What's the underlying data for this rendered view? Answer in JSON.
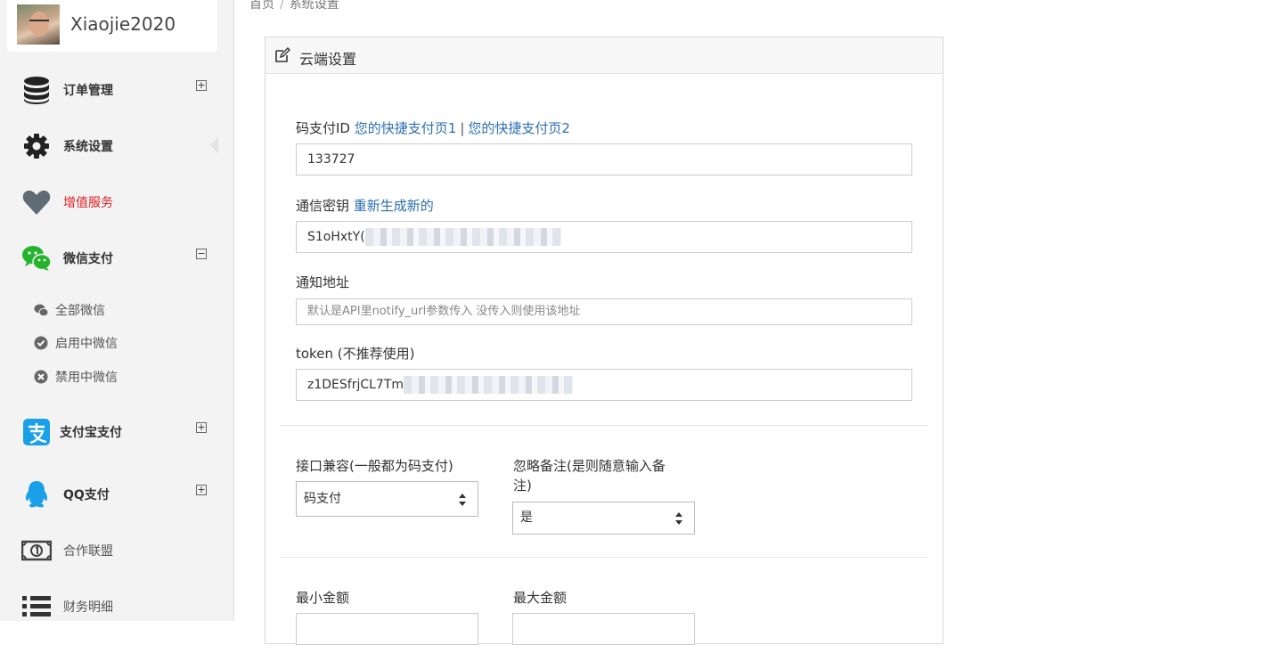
{
  "profile": {
    "username": "Xiaojie2020"
  },
  "sidebar": {
    "items": [
      {
        "label": "订单管理",
        "icon": "database-icon",
        "toggle": "+"
      },
      {
        "label": "系统设置",
        "icon": "gear-icon"
      },
      {
        "label": "增值服务",
        "icon": "heart-icon"
      },
      {
        "label": "微信支付",
        "icon": "wechat-icon",
        "toggle": "−"
      },
      {
        "label": "支付宝支付",
        "icon": "alipay-icon",
        "toggle": "+"
      },
      {
        "label": "QQ支付",
        "icon": "qq-icon",
        "toggle": "+"
      },
      {
        "label": "合作联盟",
        "icon": "money-icon"
      },
      {
        "label": "财务明细",
        "icon": "list-icon"
      }
    ],
    "wechat_sub": [
      {
        "label": "全部微信",
        "icon": "wechat-small-icon"
      },
      {
        "label": "启用中微信",
        "icon": "check-circle-icon"
      },
      {
        "label": "禁用中微信",
        "icon": "x-circle-icon"
      }
    ]
  },
  "breadcrumb": {
    "home": "首页",
    "current": "系统设置"
  },
  "panel": {
    "title": "云端设置",
    "pay_id_label": "码支付ID",
    "pay_link1": "您的快捷支付页1",
    "pay_link_sep": "|",
    "pay_link2": "您的快捷支付页2",
    "pay_id_value": "133727",
    "key_label": "通信密钥",
    "key_regen": "重新生成新的",
    "key_value": "S1oHxtY(",
    "notify_label": "通知地址",
    "notify_placeholder": "默认是API里notify_url参数传入 没传入则使用该地址",
    "token_label": "token (不推荐使用)",
    "token_value": "z1DESfrjCL7Tm",
    "compat_label": "接口兼容(一般都为码支付)",
    "compat_value": "码支付",
    "ignore_label_line1": "忽略备注(是则随意输入备",
    "ignore_label_line2": "注)",
    "ignore_value": "是",
    "min_label": "最小金额",
    "max_label": "最大金额"
  }
}
